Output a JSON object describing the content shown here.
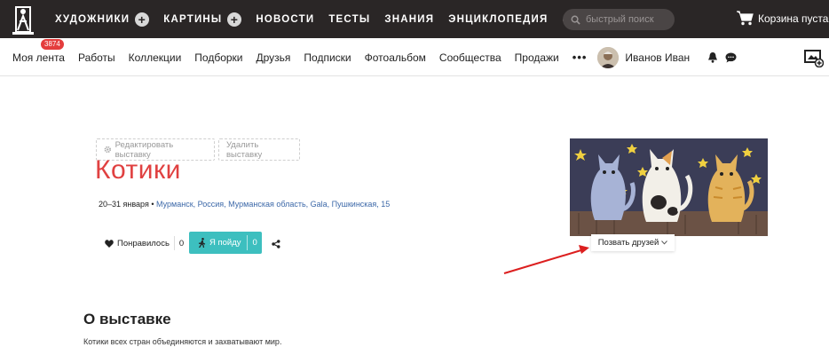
{
  "header": {
    "nav": [
      {
        "label": "Художники",
        "plus": true
      },
      {
        "label": "Картины",
        "plus": true
      },
      {
        "label": "Новости",
        "plus": false
      },
      {
        "label": "Тесты",
        "plus": false
      },
      {
        "label": "Знания",
        "plus": false
      },
      {
        "label": "Энциклопедия",
        "plus": false
      }
    ],
    "more_icon": "•••",
    "search_placeholder": "быстрый поиск",
    "cart_label": "Корзина пуста"
  },
  "subnav": {
    "items": [
      "Моя лента",
      "Работы",
      "Коллекции",
      "Подборки",
      "Друзья",
      "Подписки",
      "Фотоальбом",
      "Сообщества",
      "Продажи"
    ],
    "feed_badge": "3874",
    "more_icon": "•••",
    "user_name": "Иванов Иван"
  },
  "exhibition": {
    "edit_label": "Редактировать выставку",
    "delete_label": "Удалить выставку",
    "title": "Котики",
    "dates": "20–31 января",
    "separator": "•",
    "location": "Мурманск, Россия, Мурманская область, Gala, Пушкинская, 15",
    "like_label": "Понравилось",
    "like_count": "0",
    "go_label": "Я пойду",
    "go_count": "0",
    "invite_label": "Позвать друзей"
  },
  "about": {
    "title": "О выставке",
    "text": "Котики всех стран объединяются и захватывают мир."
  },
  "colors": {
    "topbar": "#2a2626",
    "accent_red": "#e04141",
    "teal": "#3dbfbf",
    "link": "#3c68a8",
    "badge": "#e43d3d"
  }
}
